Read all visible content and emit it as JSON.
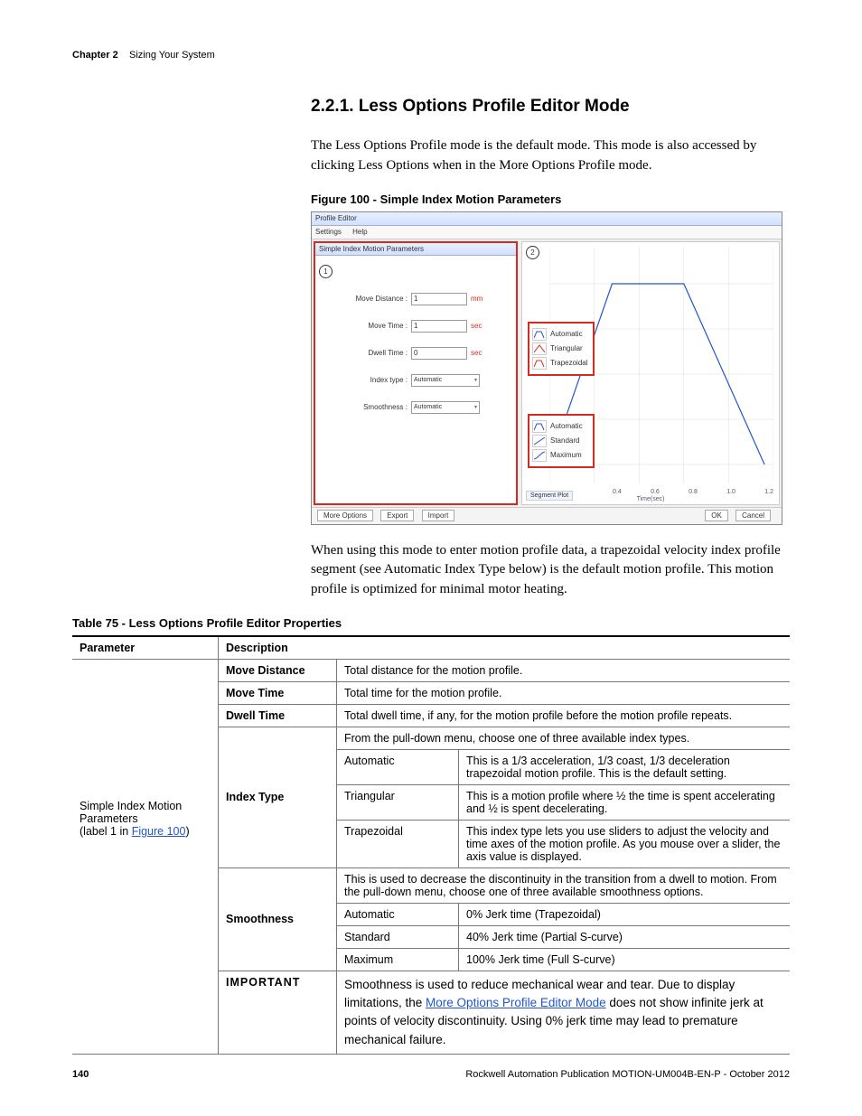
{
  "running_head": {
    "chapter": "Chapter 2",
    "title": "Sizing Your System"
  },
  "heading": "2.2.1.   Less Options Profile Editor Mode",
  "intro_para": "The Less Options Profile mode is the default mode. This mode is also accessed by clicking Less Options when in the More Options Profile mode.",
  "figure_caption": "Figure 100 - Simple Index Motion Parameters",
  "after_figure_para": "When using this mode to enter motion profile data, a trapezoidal velocity index profile segment (see Automatic Index Type below) is the default motion profile. This motion profile is optimized for minimal motor heating.",
  "table_caption": "Table 75 - Less Options Profile Editor Properties",
  "table_headers": {
    "parameter": "Parameter",
    "description": "Description"
  },
  "param_group": {
    "label_line1": "Simple Index Motion",
    "label_line2": "Parameters",
    "label_line3_prefix": "(label 1 in ",
    "label_line3_link": "Figure 100",
    "label_line3_suffix": ")"
  },
  "rows": {
    "move_distance": {
      "name": "Move Distance",
      "desc": "Total distance for the motion profile."
    },
    "move_time": {
      "name": "Move Time",
      "desc": "Total time for the motion profile."
    },
    "dwell_time": {
      "name": "Dwell Time",
      "desc": "Total dwell time, if any, for the motion profile before the motion profile repeats."
    },
    "index_type": {
      "name": "Index Type",
      "intro": "From the pull-down menu, choose one of three available index types.",
      "automatic": {
        "name": "Automatic",
        "desc": "This is a 1/3 acceleration, 1/3 coast, 1/3 deceleration trapezoidal motion profile. This is the default setting."
      },
      "triangular": {
        "name": "Triangular",
        "desc": "This is a motion profile where ½ the time is spent accelerating and ½ is spent decelerating."
      },
      "trapezoidal": {
        "name": "Trapezoidal",
        "desc": "This index type lets you use sliders to adjust the velocity and time axes of the motion profile. As you mouse over a slider, the axis value is displayed."
      }
    },
    "smoothness": {
      "name": "Smoothness",
      "intro": "This is used to decrease the discontinuity in the transition from a dwell to motion. From the pull-down menu, choose one of three available smoothness options.",
      "automatic": {
        "name": "Automatic",
        "desc": "0% Jerk time (Trapezoidal)"
      },
      "standard": {
        "name": "Standard",
        "desc": "40% Jerk time (Partial S-curve)"
      },
      "maximum": {
        "name": "Maximum",
        "desc": "100% Jerk time (Full S-curve)"
      }
    },
    "important": {
      "label": "IMPORTANT",
      "text_pre": "Smoothness is used to reduce mechanical wear and tear. Due to display limitations, the ",
      "link": "More Options Profile Editor Mode",
      "text_post": " does not show infinite jerk at points of velocity discontinuity. Using 0% jerk time may lead to premature mechanical failure."
    }
  },
  "screenshot": {
    "title": "Profile Editor",
    "menu": {
      "settings": "Settings",
      "help": "Help"
    },
    "panel_title": "Simple Index Motion Parameters",
    "callout1": "1",
    "callout2": "2",
    "fields": {
      "move_distance": {
        "label": "Move Distance :",
        "value": "1",
        "unit": "mm"
      },
      "move_time": {
        "label": "Move Time :",
        "value": "1",
        "unit": "sec"
      },
      "dwell_time": {
        "label": "Dwell Time :",
        "value": "0",
        "unit": "sec"
      },
      "index_type": {
        "label": "Index type :",
        "value": "Automatic"
      },
      "smoothness": {
        "label": "Smoothness :",
        "value": "Automatic"
      }
    },
    "popup_index": [
      "Automatic",
      "Triangular",
      "Trapezoidal"
    ],
    "popup_smooth": [
      "Automatic",
      "Standard",
      "Maximum"
    ],
    "segment_plot_label": "Segment Plot",
    "x_label": "Time(sec)",
    "x_ticks": [
      "0.4",
      "0.6",
      "0.8",
      "1.0",
      "1.2"
    ],
    "buttons": {
      "more": "More Options",
      "export": "Export",
      "import": "Import",
      "ok": "OK",
      "cancel": "Cancel"
    }
  },
  "footer": {
    "page": "140",
    "pub": "Rockwell Automation Publication MOTION-UM004B-EN-P - October 2012"
  }
}
